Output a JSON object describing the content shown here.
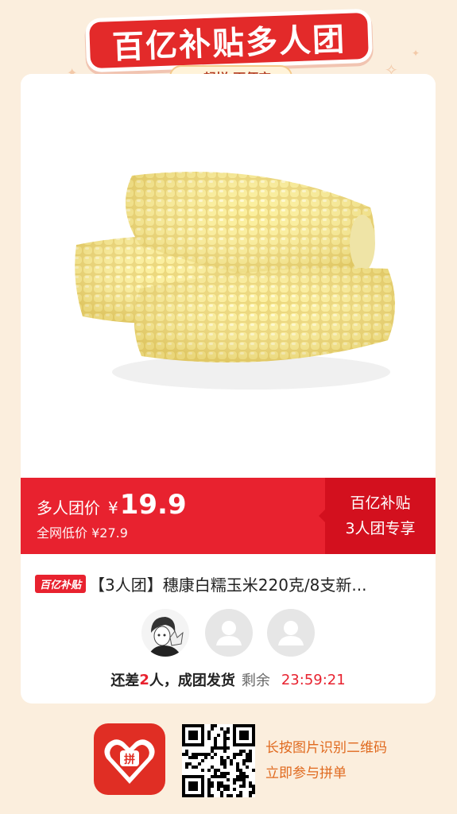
{
  "banner": {
    "title": "百亿补贴多人团",
    "subtitle": "一起拼 更便宜"
  },
  "price": {
    "group_label": "多人团价",
    "currency": "¥",
    "group_value": "19.9",
    "reference_text": "全网低价 ¥27.9"
  },
  "badge": {
    "line1": "百亿补贴",
    "line2": "3人团专享"
  },
  "product": {
    "tag": "百亿补贴",
    "title": "【3人团】穗康白糯玉米220克/8支新..."
  },
  "status": {
    "prefix": "还差",
    "count": "2",
    "suffix": "人，成团发货",
    "remaining_label": "剩余",
    "countdown": "23:59:21"
  },
  "footer": {
    "cta_line1": "长按图片识别二维码",
    "cta_line2": "立即参与拼单",
    "app_logo_text": "拼"
  },
  "colors": {
    "accent_red": "#e8222f",
    "dark_red": "#d3101e",
    "background": "#fbeedd",
    "cta_orange": "#e06a1f"
  }
}
